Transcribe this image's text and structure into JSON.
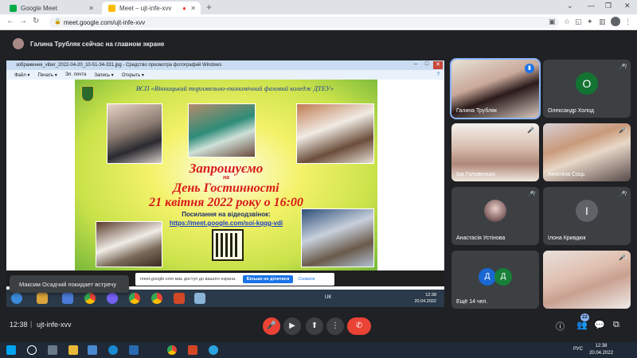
{
  "browser": {
    "tabs": [
      {
        "title": "Google Meet"
      },
      {
        "title": "Meet – ujt-infe-xvv"
      }
    ],
    "url": "meet.google.com/ujt-infe-xvv"
  },
  "meet": {
    "presenter_banner": "Галина Трубляк сейчас на главном экране",
    "toast": "Максим Осадчий покидает встречу",
    "time": "12:38",
    "separator": "|",
    "meeting_code": "ujt-infe-xvv",
    "participants_count": "22",
    "participants": [
      {
        "name": "Галина Трубляк",
        "video": true,
        "speaking": true
      },
      {
        "name": "Олександр Холод",
        "initial": "О",
        "color": "#137333"
      },
      {
        "name": "Іра Головенько",
        "video": true
      },
      {
        "name": "Ангеліна Соць",
        "video": true
      },
      {
        "name": "Анастасія Устінова",
        "video": true
      },
      {
        "name": "Ілона Кривдюк",
        "initial": "І",
        "color": "#5f6368"
      },
      {
        "name": "Ещё 14 чел.",
        "initials": [
          "Д",
          "Д"
        ],
        "colors": [
          "#1967d2",
          "#188038"
        ]
      },
      {
        "name": "",
        "video": true
      }
    ]
  },
  "shared_screen": {
    "viewer_title": "зображення_viber_2022-04-20_10-51-34-331.jpg - Средство просмотра фотографий Windows",
    "menu": [
      "Файл ▾",
      "Печать ▾",
      "Эл. почта",
      "Запись ▾",
      "Открыть ▾"
    ],
    "poster": {
      "org": "ВСП «Вінницький торговельно-економічний фаховий коледж ДТЕУ»",
      "invite": "Запрошуємо",
      "na": "на",
      "event": "День Гостинності",
      "date": "21 квітня 2022 року о 16:00",
      "link_label": "Посилання на відеодзвінок:",
      "link": "https://meet.google.com/soi-kqqg-vdi"
    },
    "share_bar": {
      "text": "meet.google.com має доступ до вашого екрана.",
      "stop": "Більше не ділитися",
      "hide": "Сховати"
    },
    "taskbar_lang": "UK",
    "taskbar_time": "12:38",
    "taskbar_date": "20.04.2022"
  },
  "host_taskbar": {
    "lang": "РУС",
    "time": "12:38",
    "date": "20.04.2022"
  }
}
